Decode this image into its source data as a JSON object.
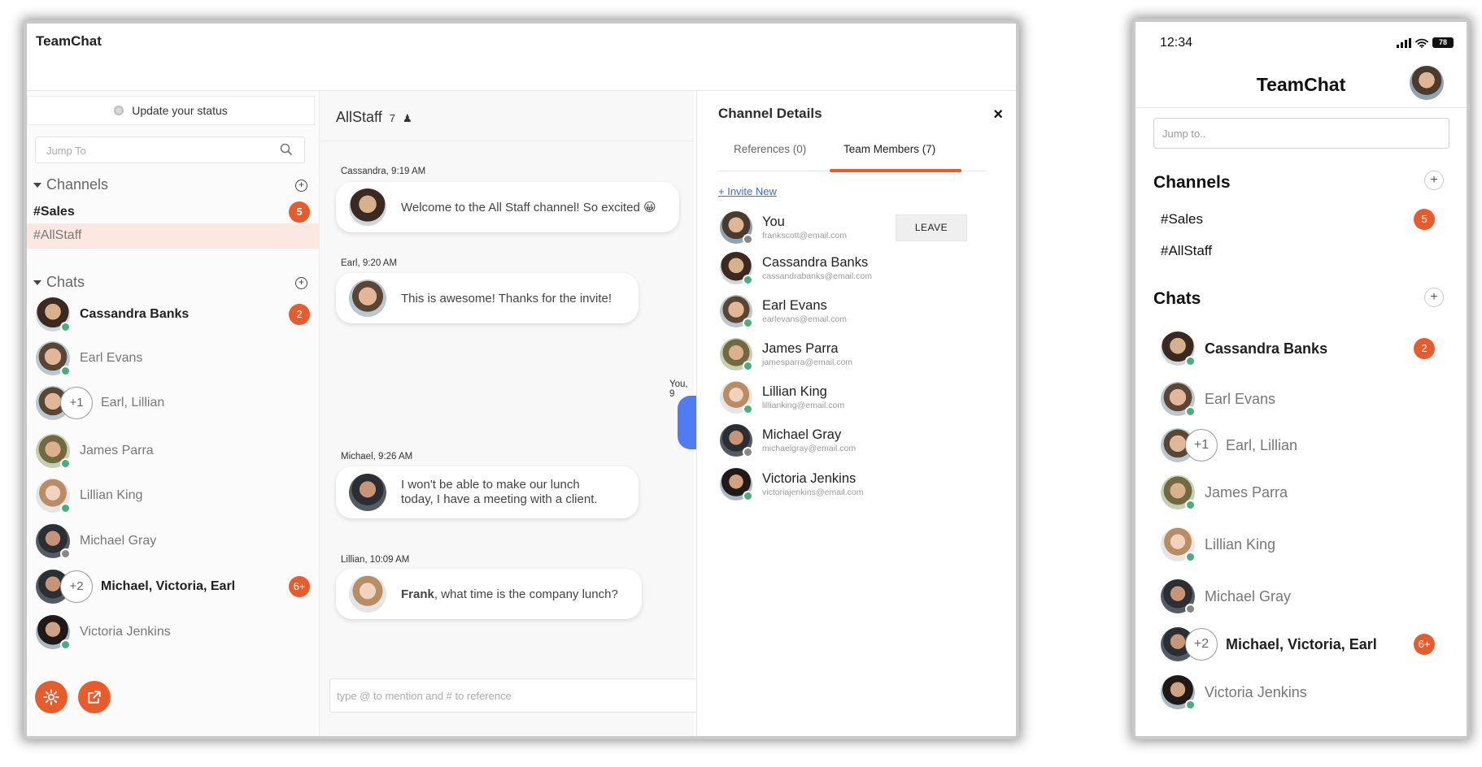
{
  "app": {
    "name": "TeamChat"
  },
  "sidebar": {
    "status_label": "Update your status",
    "jump_placeholder": "Jump To",
    "channels_label": "Channels",
    "channels": [
      {
        "name": "#Sales",
        "badge": "5"
      },
      {
        "name": "#AllStaff",
        "badge": ""
      }
    ],
    "chats_label": "Chats",
    "chats": [
      {
        "name": "Cassandra Banks",
        "badge": "2",
        "extra": ""
      },
      {
        "name": "Earl Evans",
        "badge": "",
        "extra": ""
      },
      {
        "name": "Earl, Lillian",
        "badge": "",
        "extra": "+1"
      },
      {
        "name": "James Parra",
        "badge": "",
        "extra": ""
      },
      {
        "name": "Lillian King",
        "badge": "",
        "extra": ""
      },
      {
        "name": "Michael Gray",
        "badge": "",
        "extra": ""
      },
      {
        "name": "Michael, Victoria, Earl",
        "badge": "6+",
        "extra": "+2"
      },
      {
        "name": "Victoria Jenkins",
        "badge": "",
        "extra": ""
      }
    ]
  },
  "channel": {
    "name": "AllStaff",
    "member_count": "7",
    "messages": [
      {
        "meta": "Cassandra, 9:19 AM",
        "text": "Welcome to the All Staff channel! So excited 😀"
      },
      {
        "meta": "Earl, 9:20 AM",
        "text": "This is awesome! Thanks for the invite!"
      },
      {
        "meta": "Michael, 9:26 AM",
        "text": "I won't be able to make our lunch today, I have a meeting with a client."
      },
      {
        "meta": "Lillian, 10:09 AM",
        "mention": "Frank",
        "text": ", what time is the company lunch?"
      }
    ],
    "own_meta": "You, 9",
    "compose_placeholder": "type @ to mention and # to reference"
  },
  "details": {
    "title": "Channel Details",
    "close_icon": "×",
    "tabs": [
      "References (0)",
      "Team Members (7)"
    ],
    "active_tab": "Team Members (7)",
    "invite_label": "+ Invite New",
    "leave_label": "LEAVE",
    "members": [
      {
        "name": "You",
        "email": "frankscott@email.com"
      },
      {
        "name": "Cassandra Banks",
        "email": "cassandrabanks@email.com"
      },
      {
        "name": "Earl Evans",
        "email": "earlevans@email.com"
      },
      {
        "name": "James Parra",
        "email": "jamesparra@email.com"
      },
      {
        "name": "Lillian King",
        "email": "lillianking@email.com"
      },
      {
        "name": "Michael Gray",
        "email": "michaelgray@email.com"
      },
      {
        "name": "Victoria Jenkins",
        "email": "victoriajenkins@email.com"
      }
    ]
  },
  "mobile": {
    "time": "12:34",
    "battery": "78",
    "title": "TeamChat",
    "jump_placeholder": "Jump to..",
    "channels_label": "Channels",
    "chats_label": "Chats",
    "add_icon": "+"
  },
  "colors": {
    "accent": "#e95b2a",
    "online": "#45b07e",
    "link": "#2f6fe0",
    "own_bubble": "#4f7cf3"
  }
}
